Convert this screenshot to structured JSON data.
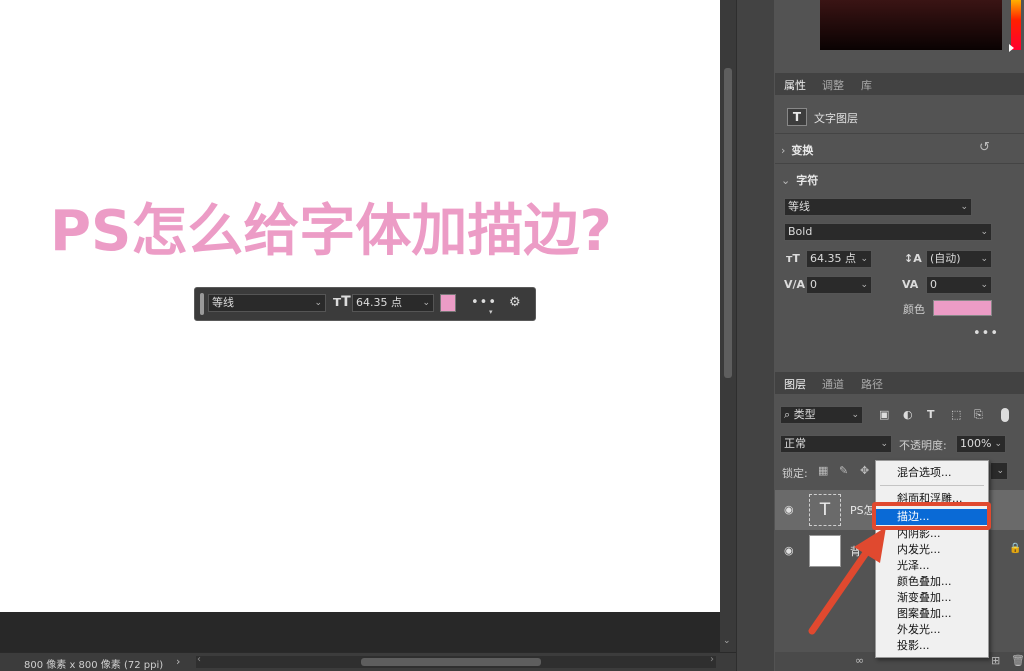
{
  "canvas": {
    "headline": "PS怎么给字体加描边?",
    "headline_color": "#ec9cc6"
  },
  "status_bar": {
    "doc_size": "800 像素 x 800 像素 (72 ppi)",
    "arrow": "›"
  },
  "context_toolbar": {
    "font": "等线",
    "size_icon": "ᴛT",
    "size": "64.35 点",
    "swatch_color": "#ec9cc6",
    "more": "•••",
    "settings_icon": "⚙"
  },
  "properties_panel": {
    "tabs": [
      "属性",
      "调整",
      "库"
    ],
    "type_icon": "T",
    "type_label": "文字图层",
    "transform_section": "变换",
    "character_section": "字符",
    "font_family": "等线",
    "font_style": "Bold",
    "size_value": "64.35 点",
    "leading_value": "(自动)",
    "kerning_value": "0",
    "tracking_value": "0",
    "color_label": "颜色",
    "color_value": "#ec9cc6",
    "more": "•••"
  },
  "layers_panel": {
    "tabs": [
      "图层",
      "通道",
      "路径"
    ],
    "filter_label": "类型",
    "blend_mode": "正常",
    "opacity_label": "不透明度:",
    "opacity_value": "100%",
    "lock_label": "锁定:",
    "layers": [
      {
        "name": "PS怎",
        "thumb": "T"
      },
      {
        "name": "背景",
        "thumb": ""
      }
    ]
  },
  "context_menu": {
    "items": [
      "混合选项...",
      "斜面和浮雕...",
      "描边...",
      "内阴影...",
      "内发光...",
      "光泽...",
      "颜色叠加...",
      "渐变叠加...",
      "图案叠加...",
      "外发光...",
      "投影..."
    ],
    "highlighted": "描边...",
    "annotation_color": "#e0492f"
  }
}
